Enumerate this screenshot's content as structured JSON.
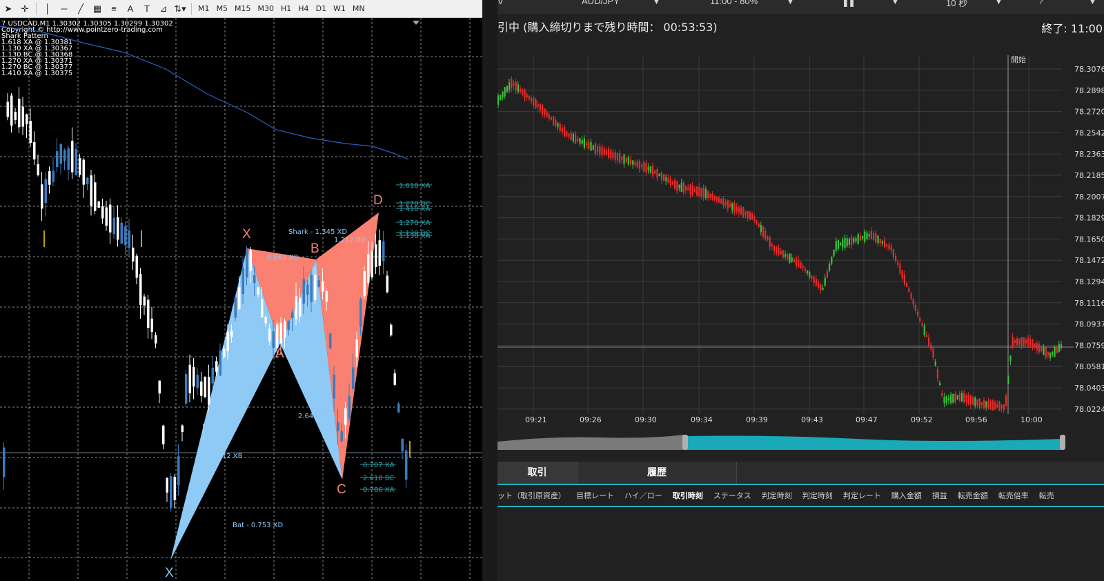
{
  "left": {
    "toolbar": {
      "timeframes": [
        "M1",
        "M5",
        "M15",
        "M30",
        "H1",
        "H4",
        "D1",
        "W1",
        "MN"
      ],
      "text_tool": "A"
    },
    "info_lines": [
      "7 USDCAD,M1  1.30302 1.30305 1.30299 1.30302",
      "Copyright © http://www.pointzero-trading.com",
      "Shark Pattern",
      "1.618 XA @ 1.30381",
      "1.130 XA @ 1.30367",
      "1.130 BC @ 1.30368",
      "1.270 XA @ 1.30371",
      "1.270 BC @ 1.30377",
      "1.410 XA @ 1.30375"
    ],
    "pattern_points": {
      "x1": "X",
      "a": "A",
      "b": "B",
      "c": "C",
      "d": "D",
      "x0": "X"
    },
    "annotations": {
      "ratio_xb_top": "0.862 XB",
      "shark": "Shark - 1.345 XD",
      "bd": "1.212 BD",
      "ac": "2.640 AC",
      "xb_low": "0.312 XB",
      "bat": "Bat - 0.753 XD"
    },
    "levels": [
      "1.618 XA",
      "1.270 BC",
      "1.410 XA",
      "1.270 XA",
      "1.130 BC",
      "1.130 XA",
      "0.707 XA",
      "2.618 BC",
      "0.786 XA"
    ],
    "colors": {
      "bullish": "#3a7bbf",
      "bearish": "#ffffff",
      "bat_fill": "#8fc9f5",
      "shark_fill": "#fa8072",
      "ma": "#2a62c4",
      "grid": "#8a8a8a",
      "level": "#2a9fa8"
    }
  },
  "right": {
    "top_labels": {
      "pair": "AUD/JPY",
      "window": "11:00 - 80%",
      "interval": "10 秒"
    },
    "status": "引中 (購入締切りまで残り時間： 00:53:53)",
    "end_time": "終了: 11:00",
    "start_label": "開始",
    "price_ticks": [
      "78.3076",
      "78.2898",
      "78.2720",
      "78.2542",
      "78.2363",
      "78.2185",
      "78.2007",
      "78.1829",
      "78.1650",
      "78.1472",
      "78.1294",
      "78.1116",
      "78.0937",
      "78.0759",
      "78.0581",
      "78.0403",
      "78.0224"
    ],
    "time_ticks": [
      "09:21",
      "09:26",
      "09:30",
      "09:34",
      "09:39",
      "09:43",
      "09:47",
      "09:52",
      "09:56",
      "10:00"
    ],
    "tabs": [
      "取引",
      "履歴"
    ],
    "columns": [
      "ット（取引原資産）",
      "目標レート",
      "ハイ／ロー",
      "取引時刻",
      "ステータス",
      "判定時刻",
      "判定時刻",
      "判定レート",
      "購入金額",
      "損益",
      "転売金額",
      "転売倍率",
      "転売"
    ],
    "active_column": "取引時刻",
    "colors": {
      "up": "#3cc23c",
      "down": "#e42c2c",
      "accent": "#21b4c8"
    }
  }
}
